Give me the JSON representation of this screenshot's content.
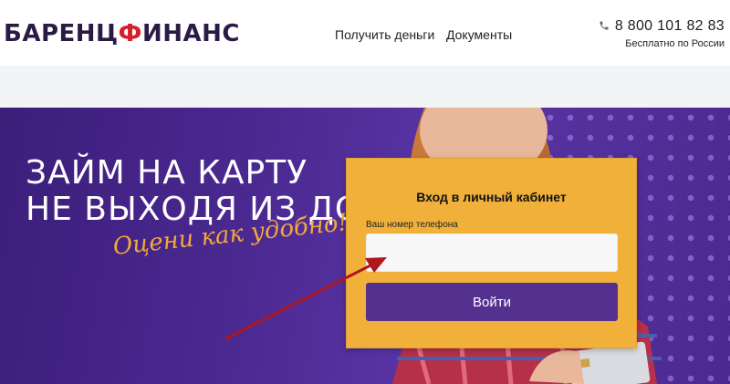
{
  "header": {
    "logo": {
      "part1": "БАРЕНЦ",
      "accent": "Ф",
      "part2": "ИНАНС"
    },
    "nav": [
      {
        "label": "Получить деньги"
      },
      {
        "label": "Документы"
      }
    ],
    "phone": {
      "icon": "phone-icon",
      "number": "8 800 101 82 83",
      "note": "Бесплатно по России"
    }
  },
  "hero": {
    "title_line1": "ЗАЙМ НА КАРТУ",
    "title_line2": "НЕ ВЫХОДЯ ИЗ ДОМА",
    "slogan": "Оцени как удобно!"
  },
  "login": {
    "title": "Вход в личный кабинет",
    "phone_label": "Ваш номер телефона",
    "phone_value": "",
    "submit_label": "Войти"
  },
  "colors": {
    "brand_purple": "#55318f",
    "card_yellow": "#f0b03a",
    "logo_dark": "#2a1b45",
    "logo_accent": "#d6202a",
    "slogan_orange": "#f2a93b",
    "arrow_red": "#b0161c"
  }
}
